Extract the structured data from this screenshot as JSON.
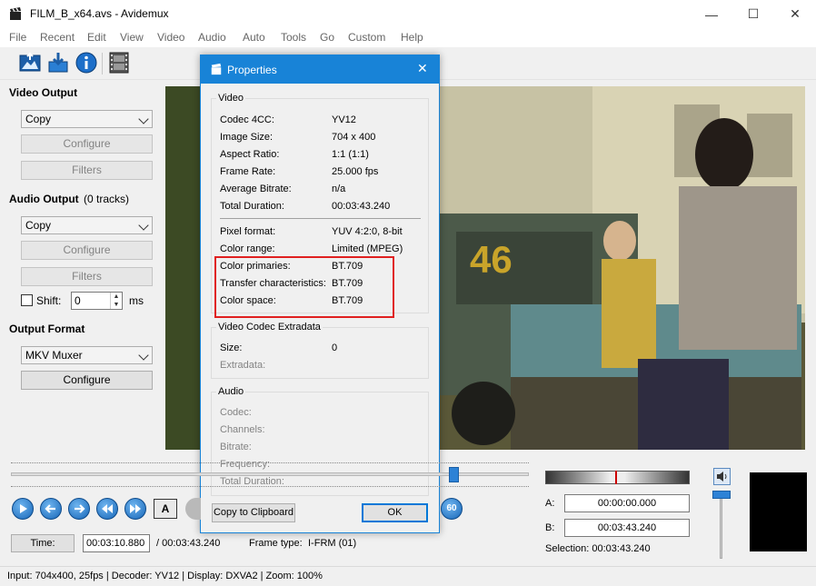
{
  "window": {
    "title": "FILM_B_x64.avs - Avidemux",
    "min_glyph": "—",
    "max_glyph": "☐",
    "close_glyph": "✕"
  },
  "menu": [
    "File",
    "Recent",
    "Edit",
    "View",
    "Video",
    "Audio",
    "Auto",
    "Tools",
    "Go",
    "Custom",
    "Help"
  ],
  "toolbar": {
    "icons": [
      "open-video-icon",
      "save-video-icon",
      "info-icon",
      "filmstrip-icon"
    ]
  },
  "left_panel": {
    "video_output": {
      "label": "Video Output",
      "codec": "Copy",
      "configure": "Configure",
      "filters": "Filters"
    },
    "audio_output": {
      "label": "Audio Output",
      "tracks": "(0 tracks)",
      "codec": "Copy",
      "configure": "Configure",
      "filters": "Filters",
      "shift_label": "Shift:",
      "shift_value": "0",
      "shift_unit": "ms"
    },
    "output_format": {
      "label": "Output Format",
      "muxer": "MKV Muxer",
      "configure": "Configure"
    }
  },
  "dialog": {
    "title": "Properties",
    "close_glyph": "✕",
    "video": {
      "label": "Video",
      "rows": [
        {
          "key": "Codec 4CC:",
          "value": "YV12"
        },
        {
          "key": "Image Size:",
          "value": "704 x 400"
        },
        {
          "key": "Aspect Ratio:",
          "value": "1:1 (1:1)"
        },
        {
          "key": "Frame Rate:",
          "value": "25.000 fps"
        },
        {
          "key": "Average Bitrate:",
          "value": "n/a"
        },
        {
          "key": "Total Duration:",
          "value": "00:03:43.240"
        }
      ],
      "rows2": [
        {
          "key": "Pixel format:",
          "value": "YUV 4:2:0, 8-bit"
        },
        {
          "key": "Color range:",
          "value": "Limited (MPEG)"
        },
        {
          "key": "Color primaries:",
          "value": "BT.709"
        },
        {
          "key": "Transfer characteristics:",
          "value": "BT.709"
        },
        {
          "key": "Color space:",
          "value": "BT.709"
        }
      ]
    },
    "extradata": {
      "label": "Video Codec Extradata",
      "rows": [
        {
          "key": "Size:",
          "value": "0"
        },
        {
          "key": "Extradata:",
          "value": ""
        }
      ]
    },
    "audio": {
      "label": "Audio",
      "rows": [
        {
          "key": "Codec:",
          "value": ""
        },
        {
          "key": "Channels:",
          "value": ""
        },
        {
          "key": "Bitrate:",
          "value": ""
        },
        {
          "key": "Frequency:",
          "value": ""
        },
        {
          "key": "Total Duration:",
          "value": ""
        }
      ]
    },
    "copy_button": "Copy to Clipboard",
    "ok_button": "OK"
  },
  "highlight_color": "#e02020",
  "playback": {
    "time_button": "Time:",
    "current_time": "00:03:10.880",
    "total_time": "/ 00:03:43.240",
    "frame_type_label": "Frame type:",
    "frame_type": "I-FRM (01)",
    "seek_fraction": 0.855,
    "goto_badge": "60"
  },
  "selection": {
    "a_label": "A:",
    "a_value": "00:00:00.000",
    "b_label": "B:",
    "b_value": "00:03:43.240",
    "selection_text": "Selection: 00:03:43.240"
  },
  "statusbar": {
    "text": "Input: 704x400, 25fps  |  Decoder: YV12  |  Display: DXVA2  |  Zoom: 100%"
  }
}
